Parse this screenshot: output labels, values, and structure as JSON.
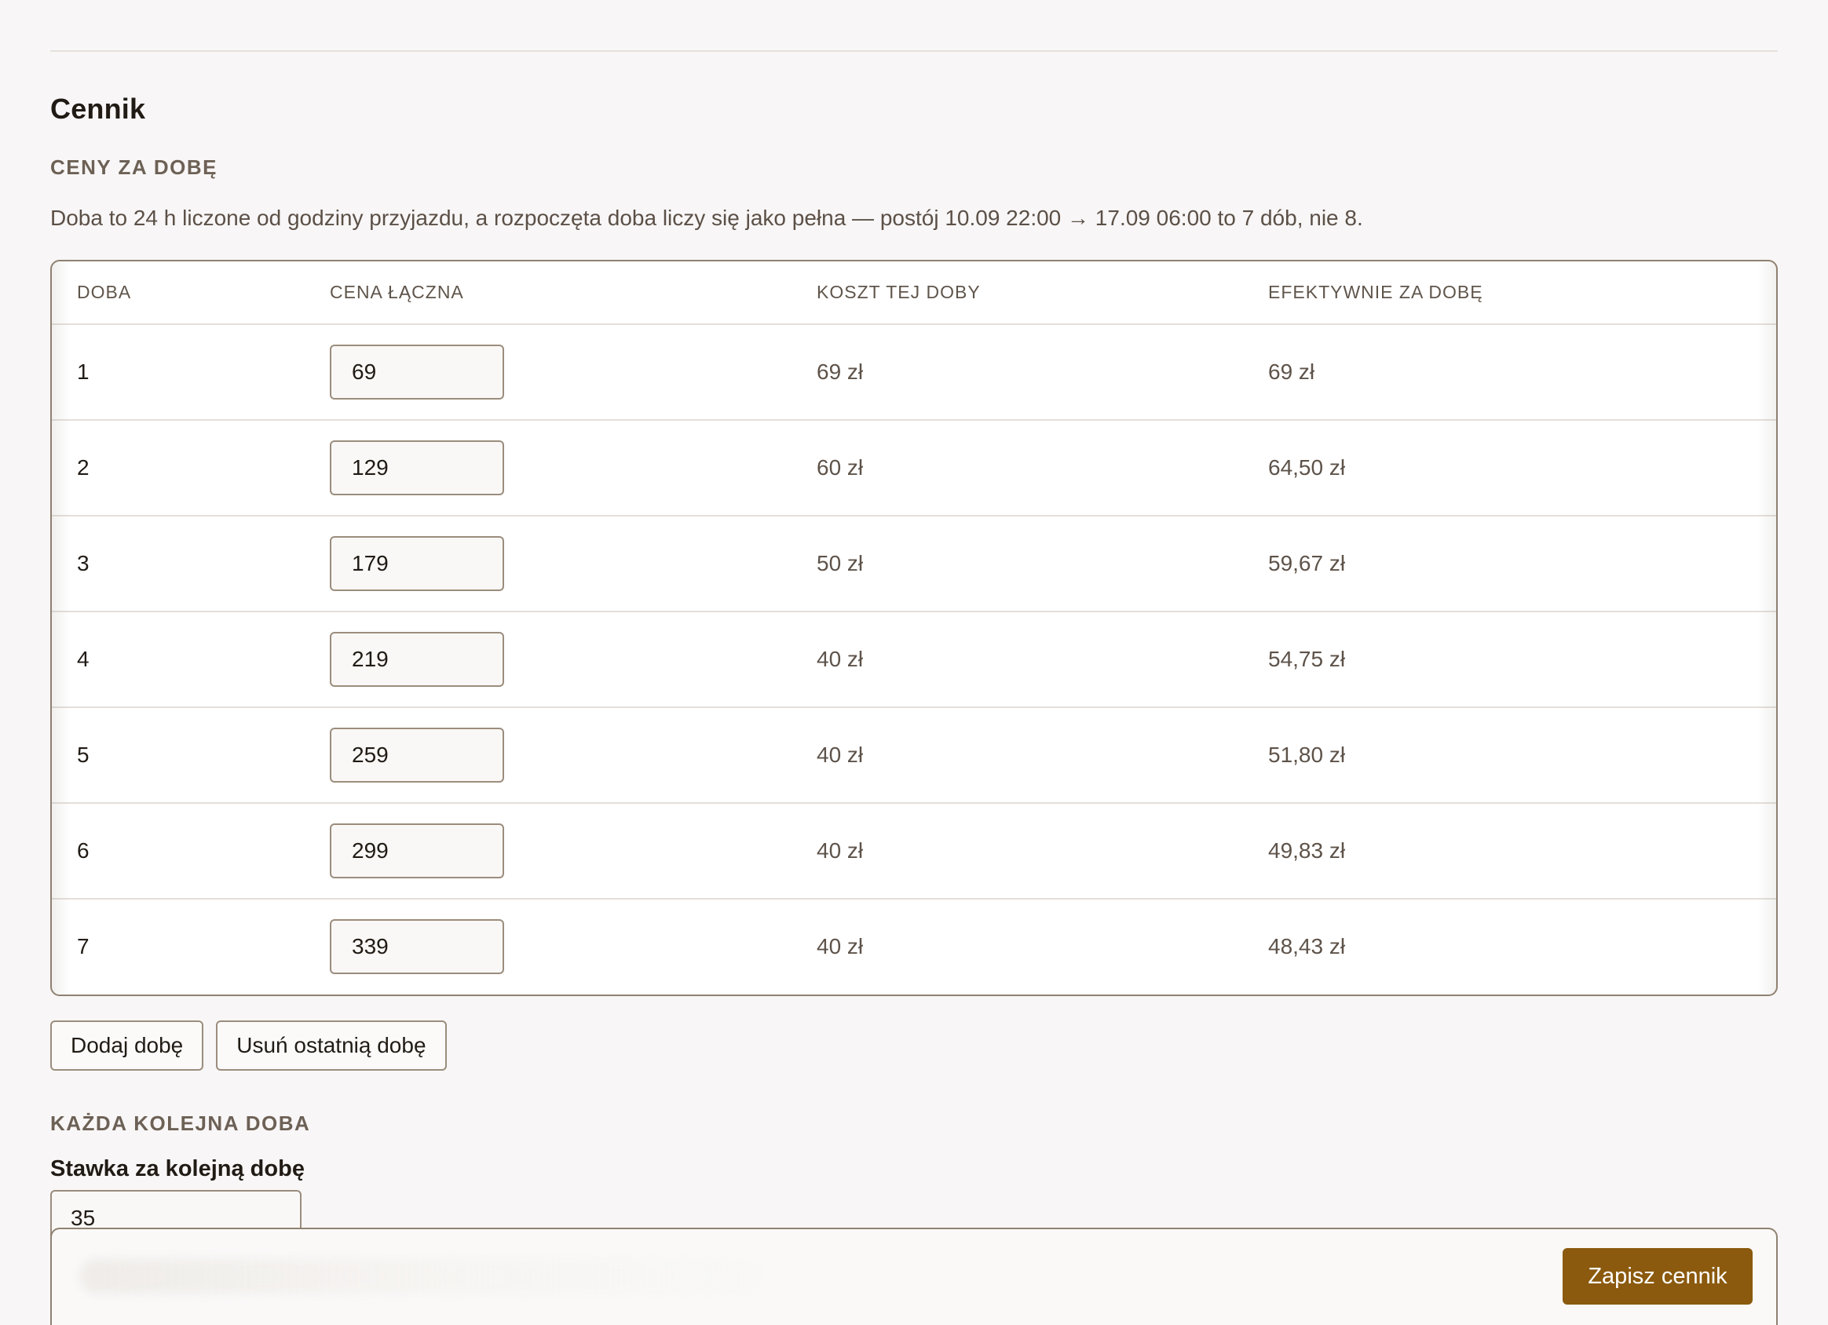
{
  "section": {
    "title": "Cennik",
    "daily_heading": "CENY ZA DOBĘ",
    "description": "Doba to 24 h liczone od godziny przyjazdu, a rozpoczęta doba liczy się jako pełna — postój 10.09 22:00 → 17.09 06:00 to 7 dób, nie 8."
  },
  "table": {
    "headers": {
      "day": "DOBA",
      "total_price": "CENA ŁĄCZNA",
      "day_cost": "KOSZT TEJ DOBY",
      "effective": "EFEKTYWNIE ZA DOBĘ"
    },
    "rows": [
      {
        "day": "1",
        "total_price": "69",
        "day_cost": "69 zł",
        "effective": "69 zł"
      },
      {
        "day": "2",
        "total_price": "129",
        "day_cost": "60 zł",
        "effective": "64,50 zł"
      },
      {
        "day": "3",
        "total_price": "179",
        "day_cost": "50 zł",
        "effective": "59,67 zł"
      },
      {
        "day": "4",
        "total_price": "219",
        "day_cost": "40 zł",
        "effective": "54,75 zł"
      },
      {
        "day": "5",
        "total_price": "259",
        "day_cost": "40 zł",
        "effective": "51,80 zł"
      },
      {
        "day": "6",
        "total_price": "299",
        "day_cost": "40 zł",
        "effective": "49,83 zł"
      },
      {
        "day": "7",
        "total_price": "339",
        "day_cost": "40 zł",
        "effective": "48,43 zł"
      }
    ]
  },
  "actions": {
    "add_day": "Dodaj dobę",
    "remove_last_day": "Usuń ostatnią dobę"
  },
  "next_day": {
    "heading": "KAŻDA KOLEJNA DOBA",
    "label": "Stawka za kolejną dobę",
    "value": "35"
  },
  "save_bar": {
    "save_label": "Zapisz cennik"
  },
  "colors": {
    "accent": "#8b5a0e",
    "background": "#f8f6f6",
    "border": "#8f8171"
  }
}
